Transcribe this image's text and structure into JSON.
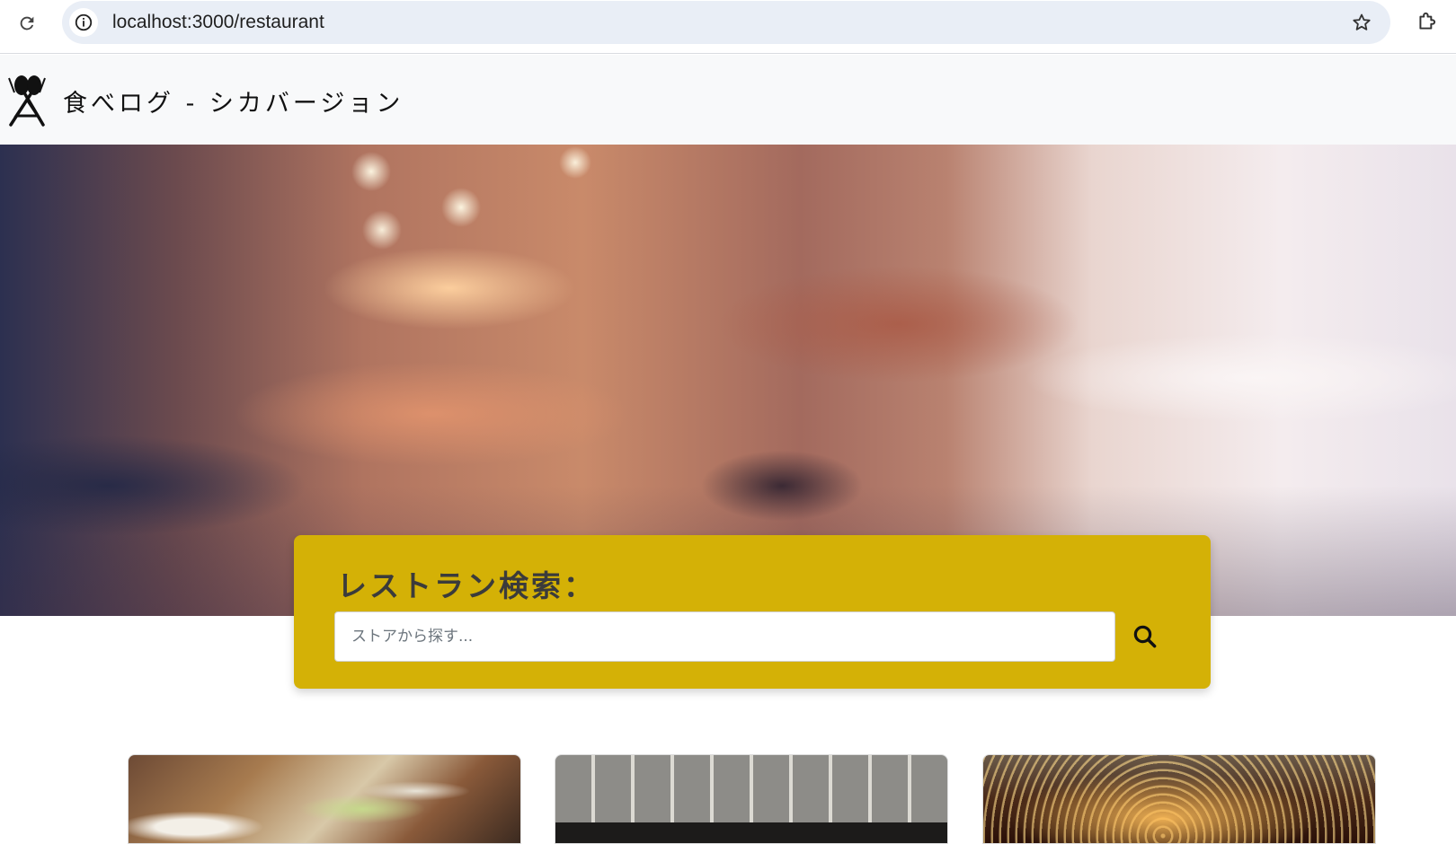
{
  "browser": {
    "url": "localhost:3000/restaurant",
    "icons": {
      "reload": "reload-icon",
      "site_info": "info-icon",
      "bookmark": "star-icon",
      "extensions": "puzzle-icon"
    }
  },
  "navbar": {
    "brand_name": "食べログ - シカバージョン",
    "logo": "fork-spoon-logo"
  },
  "search": {
    "title": "レストラン検索：",
    "placeholder": "ストアから探す...",
    "value": "",
    "button_icon": "search-icon",
    "accent_color": "#d4b106"
  },
  "cards": [
    {
      "image": "restaurant-food-photo"
    },
    {
      "image": "restaurant-storefront-photo"
    },
    {
      "image": "restaurant-interior-photo"
    }
  ]
}
